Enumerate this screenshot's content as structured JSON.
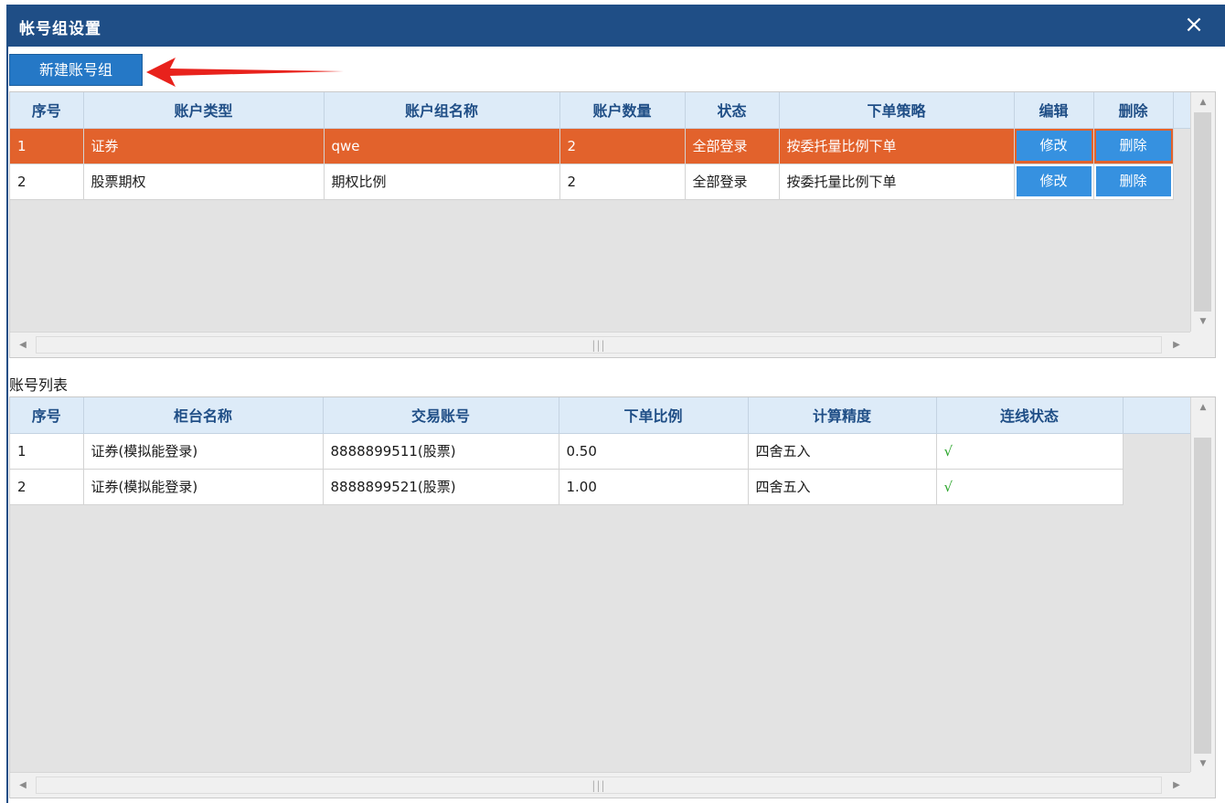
{
  "window": {
    "title": "帐号组设置",
    "close_icon": "×"
  },
  "toolbar": {
    "new_group_label": "新建账号组"
  },
  "colors": {
    "titlebar": "#1f4e86",
    "selected_row": "#e2622c",
    "header_bg": "#ddebf8",
    "cell_button": "#3691e0",
    "arrow": "#e8221c",
    "check": "#2ba62b"
  },
  "groups": {
    "columns": [
      "序号",
      "账户类型",
      "账户组名称",
      "账户数量",
      "状态",
      "下单策略",
      "编辑",
      "删除"
    ],
    "rows": [
      {
        "index": "1",
        "type": "证券",
        "name": "qwe",
        "count": "2",
        "status": "全部登录",
        "strategy": "按委托量比例下单",
        "edit_label": "修改",
        "delete_label": "删除",
        "selected": true
      },
      {
        "index": "2",
        "type": "股票期权",
        "name": "期权比例",
        "count": "2",
        "status": "全部登录",
        "strategy": "按委托量比例下单",
        "edit_label": "修改",
        "delete_label": "删除",
        "selected": false
      }
    ]
  },
  "accounts": {
    "section_label": "账号列表",
    "columns": [
      "序号",
      "柜台名称",
      "交易账号",
      "下单比例",
      "计算精度",
      "连线状态"
    ],
    "rows": [
      {
        "index": "1",
        "counter": "证券(模拟能登录)",
        "account": "8888899511(股票)",
        "ratio": "0.50",
        "precision": "四舍五入",
        "connection": "√"
      },
      {
        "index": "2",
        "counter": "证券(模拟能登录)",
        "account": "8888899521(股票)",
        "ratio": "1.00",
        "precision": "四舍五入",
        "connection": "√"
      }
    ]
  },
  "scrollbar": {
    "up_icon": "▲",
    "down_icon": "▼",
    "left_icon": "◀",
    "right_icon": "▶",
    "grip": "|||"
  }
}
